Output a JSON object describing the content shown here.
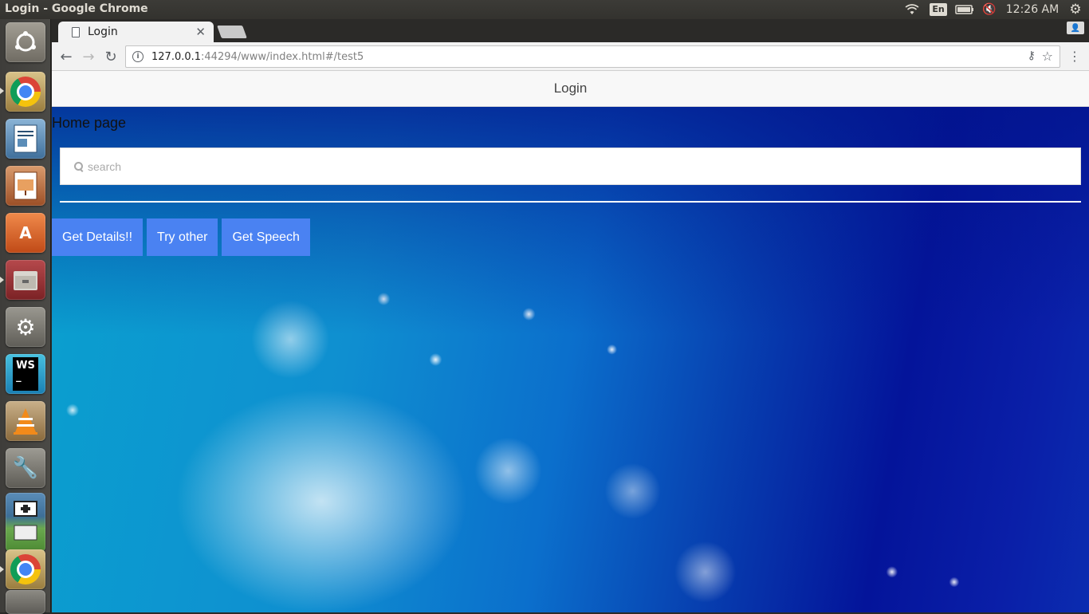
{
  "os": {
    "window_title": "Login - Google Chrome",
    "input_language": "En",
    "clock": "12:26 AM"
  },
  "launcher": {
    "apps": [
      "ubuntu-dash",
      "google-chrome",
      "libreoffice-writer",
      "libreoffice-impress",
      "ubuntu-software",
      "files",
      "system-settings",
      "webstorm",
      "vlc",
      "wine",
      "workspace-switcher",
      "google-chrome",
      "trash"
    ]
  },
  "browser": {
    "tab_title": "Login",
    "url_host": "127.0.0.1",
    "url_rest": ":44294/www/index.html#/test5"
  },
  "page": {
    "header_title": "Login",
    "title": "Home page",
    "search": {
      "placeholder": "search",
      "value": ""
    },
    "buttons": {
      "get_details": "Get Details!!",
      "try_other": "Try other",
      "get_speech": "Get Speech"
    }
  },
  "colors": {
    "button_bg": "#4a82f2",
    "panel_bg": "#3c3b37"
  }
}
